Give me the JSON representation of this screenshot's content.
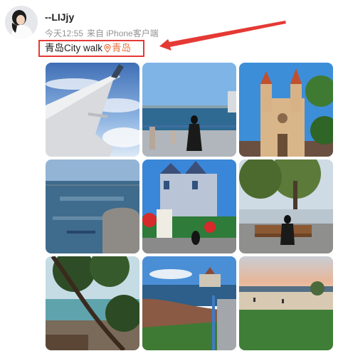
{
  "user": {
    "name": "--LIJjy",
    "avatar_icon": "profile-avatar"
  },
  "meta": {
    "time": "今天12:55",
    "source": "来自 iPhone客户端"
  },
  "post": {
    "text": "青岛City walk",
    "location": "青岛",
    "location_icon": "map-pin-icon"
  },
  "colors": {
    "highlight": "#e53935",
    "location": "#eb7340"
  },
  "photos": [
    {
      "subject": "airplane wing over clouds"
    },
    {
      "subject": "woman on seaside promenade"
    },
    {
      "subject": "twin-spired cathedral"
    },
    {
      "subject": "sea view with stone bollard"
    },
    {
      "subject": "colorful castle villa with red flags"
    },
    {
      "subject": "woman on park bench under tree"
    },
    {
      "subject": "pine tree by the coast"
    },
    {
      "subject": "rocky shore with pavilion"
    },
    {
      "subject": "beach at sunset"
    }
  ]
}
